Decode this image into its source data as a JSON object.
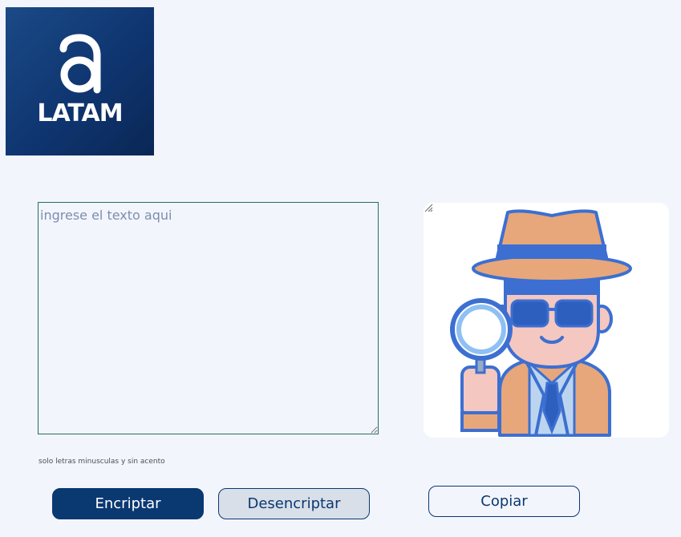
{
  "logo": {
    "brand_text": "LATAM",
    "icon": "alura-a-logo"
  },
  "input": {
    "placeholder": "ingrese el texto aqui",
    "value": ""
  },
  "output": {
    "illustration": "detective-with-magnifying-glass"
  },
  "hint": {
    "text": "solo letras minusculas y sin acento"
  },
  "buttons": {
    "encrypt_label": "Encriptar",
    "decrypt_label": "Desencriptar",
    "copy_label": "Copiar"
  },
  "colors": {
    "page_background": "#f3f5fc",
    "primary": "#0a3871",
    "secondary_button": "#d8dfe8",
    "logo_background": "#0f3570"
  }
}
